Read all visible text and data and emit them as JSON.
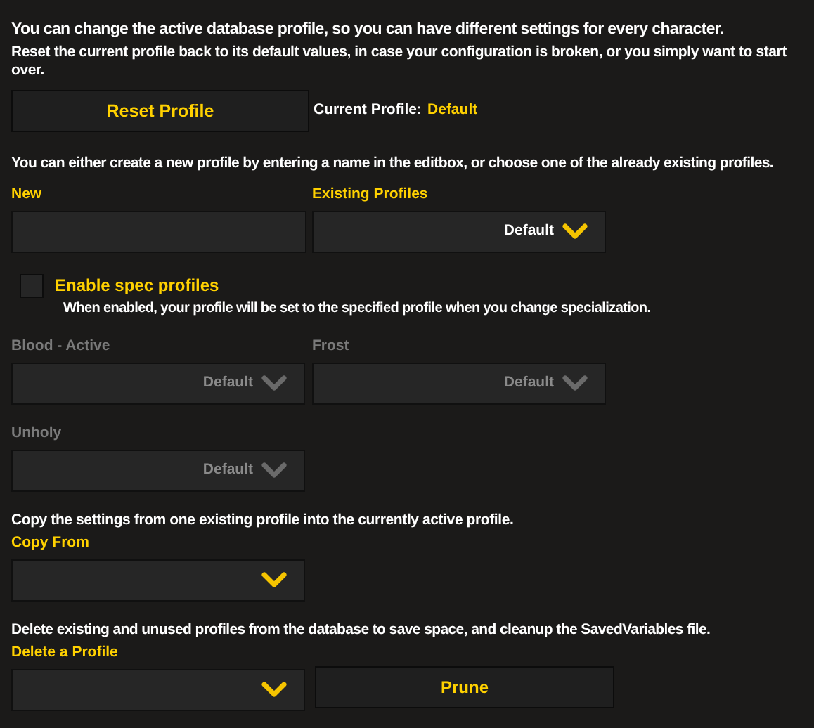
{
  "intro": "You can change the active database profile, so you can have different settings for every character.",
  "reset_hint": "Reset the current profile back to its default values, in case your configuration is broken, or you simply want to start over.",
  "reset_button": "Reset Profile",
  "current_profile": {
    "label": "Current Profile:",
    "value": "Default"
  },
  "choose_hint": "You can either create a new profile by entering a name in the editbox, or choose one of the already existing profiles.",
  "new_field": {
    "label": "New"
  },
  "existing_profiles": {
    "label": "Existing Profiles",
    "value": "Default",
    "disabled": false
  },
  "spec_profiles": {
    "label": "Enable spec profiles",
    "checked": false,
    "description": "When enabled, your profile will be set to the specified profile when you change specialization."
  },
  "spec_dropdowns": [
    {
      "label": "Blood - Active",
      "value": "Default",
      "disabled": true
    },
    {
      "label": "Frost",
      "value": "Default",
      "disabled": true
    },
    {
      "label": "Unholy",
      "value": "Default",
      "disabled": true
    }
  ],
  "copy": {
    "hint": "Copy the settings from one existing profile into the currently active profile.",
    "label": "Copy From",
    "disabled": false
  },
  "delete": {
    "hint": "Delete existing and unused profiles from the database to save space, and cleanup the SavedVariables file.",
    "label": "Delete a Profile",
    "disabled": false
  },
  "prune_button": "Prune"
}
